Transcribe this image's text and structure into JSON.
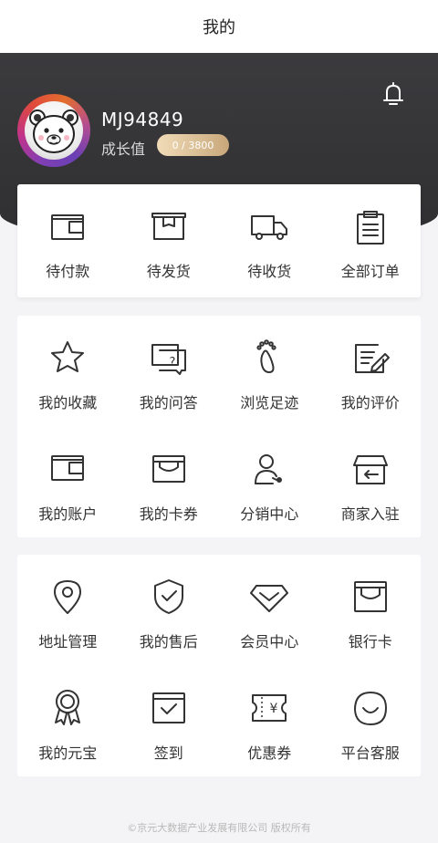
{
  "topbar": {
    "title": "我的"
  },
  "profile": {
    "username": "MJ94849",
    "growth_label": "成长值",
    "growth_value": "0 / 3800",
    "growth_progress": 0
  },
  "orders": [
    {
      "label": "待付款",
      "icon": "wallet-icon"
    },
    {
      "label": "待发货",
      "icon": "box-icon"
    },
    {
      "label": "待收货",
      "icon": "truck-icon"
    },
    {
      "label": "全部订单",
      "icon": "clipboard-icon"
    }
  ],
  "services_a": [
    {
      "label": "我的收藏",
      "icon": "star-icon"
    },
    {
      "label": "我的问答",
      "icon": "question-chat-icon"
    },
    {
      "label": "浏览足迹",
      "icon": "footprint-icon"
    },
    {
      "label": "我的评价",
      "icon": "edit-doc-icon"
    },
    {
      "label": "我的账户",
      "icon": "wallet-icon"
    },
    {
      "label": "我的卡券",
      "icon": "card-icon"
    },
    {
      "label": "分销中心",
      "icon": "user-share-icon"
    },
    {
      "label": "商家入驻",
      "icon": "store-icon"
    }
  ],
  "services_b": [
    {
      "label": "地址管理",
      "icon": "location-icon"
    },
    {
      "label": "我的售后",
      "icon": "shield-check-icon"
    },
    {
      "label": "会员中心",
      "icon": "diamond-icon"
    },
    {
      "label": "银行卡",
      "icon": "bank-card-icon"
    },
    {
      "label": "我的元宝",
      "icon": "medal-icon"
    },
    {
      "label": "签到",
      "icon": "checkin-icon"
    },
    {
      "label": "优惠券",
      "icon": "coupon-icon"
    },
    {
      "label": "平台客服",
      "icon": "service-smile-icon"
    }
  ],
  "footer": {
    "line1": "©京元大数据产业发展有限公司 版权所有"
  }
}
